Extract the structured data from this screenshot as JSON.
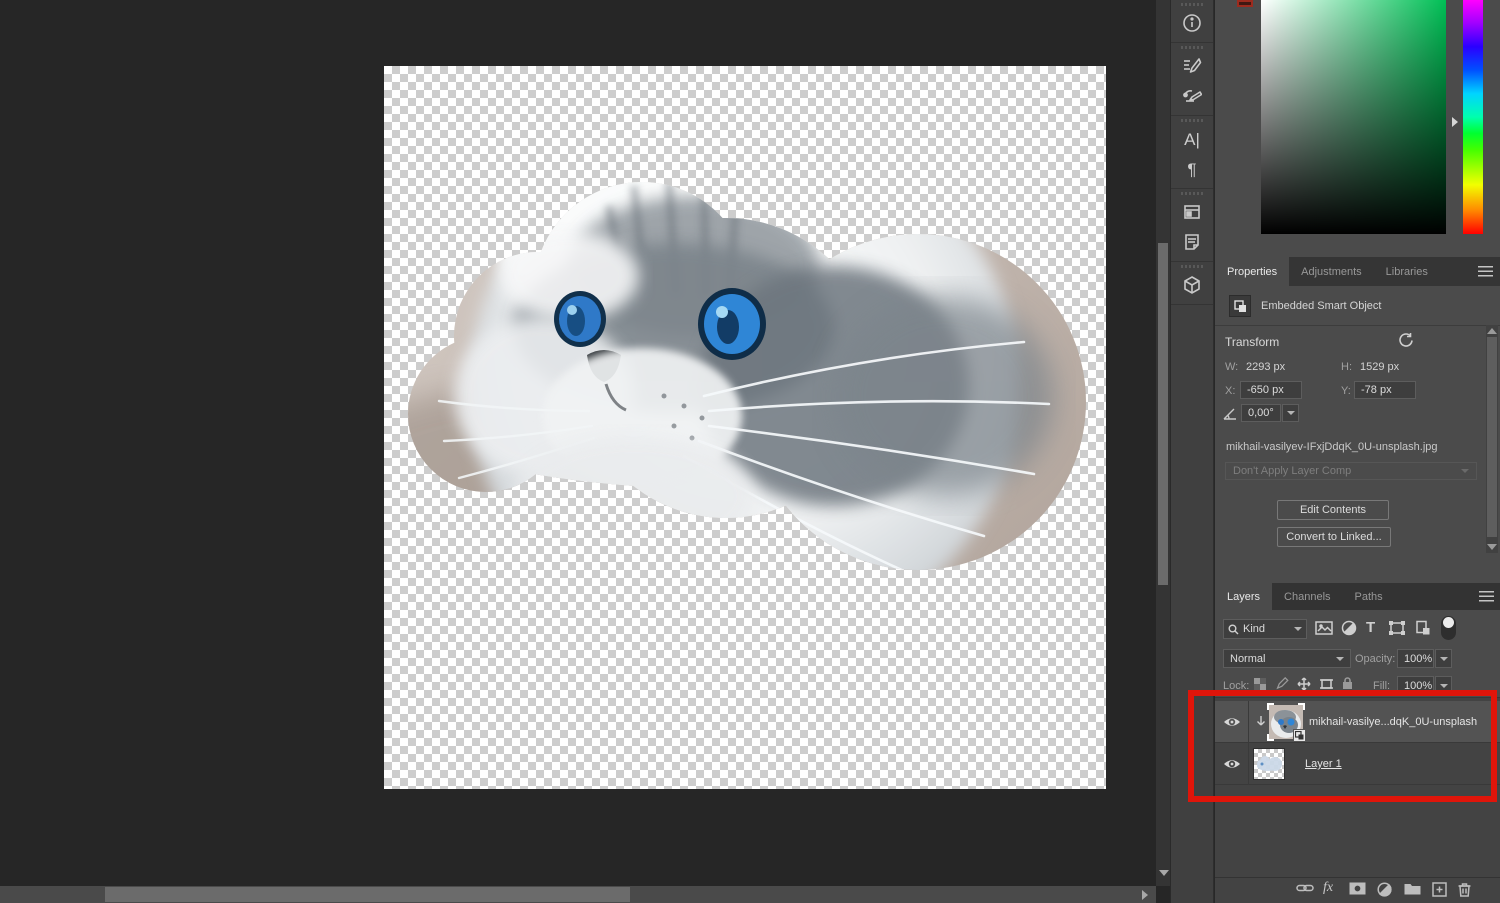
{
  "colors": {
    "canvas_surround": "#262626",
    "panel_bg": "#4b4b4b",
    "annotation_red": "#e0150a",
    "sv_field_hue": "#00bf55"
  },
  "dock": {
    "items": [
      "info-icon",
      "brush-settings-icon",
      "brushes-icon",
      "character-icon",
      "paragraph-icon",
      "layer-comps-icon",
      "notes-icon",
      "3d-icon"
    ]
  },
  "icons": {
    "character_glyph": "A",
    "paragraph_glyph": "¶",
    "type_filter_glyph": "T",
    "fx_label": "fx"
  },
  "properties_panel": {
    "tabs": [
      "Properties",
      "Adjustments",
      "Libraries"
    ],
    "header": "Embedded Smart Object",
    "transform": {
      "section_label": "Transform",
      "w_label": "W:",
      "w_value": "2293 px",
      "h_label": "H:",
      "h_value": "1529 px",
      "x_label": "X:",
      "x_value": "-650 px",
      "y_label": "Y:",
      "y_value": "-78 px",
      "angle_value": "0,00°"
    },
    "filename": "mikhail-vasilyev-IFxjDdqK_0U-unsplash.jpg",
    "layer_comp_dropdown": "Don't Apply Layer Comp",
    "edit_contents_button": "Edit Contents",
    "convert_to_linked_button": "Convert to Linked..."
  },
  "layers_panel": {
    "tabs": [
      "Layers",
      "Channels",
      "Paths"
    ],
    "kind_filter": "Kind",
    "blend_mode": "Normal",
    "opacity_label": "Opacity:",
    "opacity_value": "100%",
    "lock_label": "Lock:",
    "fill_label": "Fill:",
    "fill_value": "100%",
    "layers": [
      {
        "name": "mikhail-vasilye...dqK_0U-unsplash",
        "selected": true,
        "clipped": true
      },
      {
        "name": "Layer 1",
        "selected": false,
        "clipped": false
      }
    ]
  }
}
